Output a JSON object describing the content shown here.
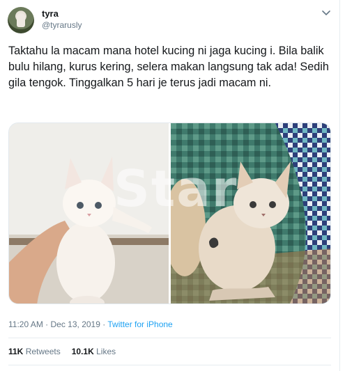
{
  "user": {
    "name": "tyra",
    "handle": "@tyrarusly"
  },
  "tweet": {
    "text": "Taktahu la macam mana hotel kucing ni jaga kucing i. Bila balik bulu hilang, kurus kering, selera makan langsung tak ada! Sedih gila tengok. Tinggalkan 5 hari je terus jadi macam ni.",
    "time": "11:20 AM",
    "date": "Dec 13, 2019",
    "separator": "·",
    "source": "Twitter for iPhone"
  },
  "media": {
    "watermark": "Star"
  },
  "stats": {
    "retweets_count": "11K",
    "retweets_label": "Retweets",
    "likes_count": "10.1K",
    "likes_label": "Likes"
  },
  "icons": {
    "menu": "chevron-down-icon"
  },
  "colors": {
    "link": "#1da1f2",
    "secondary_text": "#657786",
    "primary_text": "#14171a",
    "divider": "#e6ecf0"
  }
}
